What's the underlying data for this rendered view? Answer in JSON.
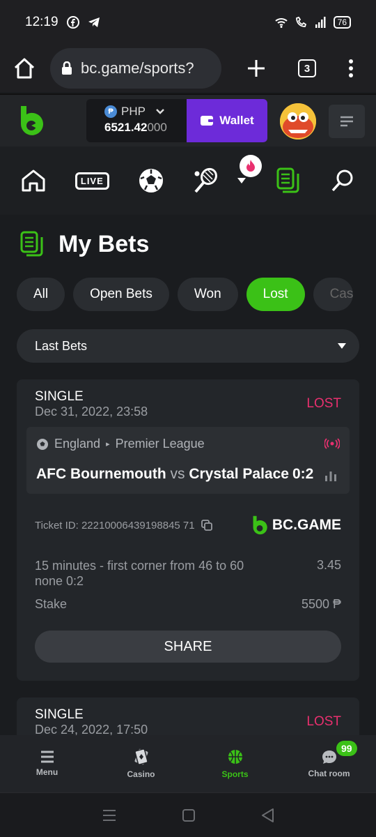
{
  "status": {
    "time": "12:19",
    "battery": "76"
  },
  "browser": {
    "url": "bc.game/sports?",
    "tab_count": "3"
  },
  "header": {
    "currency": "PHP",
    "balance_main": "6521.42",
    "balance_tail": "000",
    "wallet_label": "Wallet"
  },
  "sport_nav": {
    "live_label": "LIVE"
  },
  "page": {
    "title": "My Bets"
  },
  "filters": [
    "All",
    "Open Bets",
    "Won",
    "Lost",
    "Cas"
  ],
  "select": {
    "value": "Last Bets"
  },
  "bets": [
    {
      "type": "SINGLE",
      "date": "Dec 31, 2022, 23:58",
      "status": "LOST",
      "country": "England",
      "league": "Premier League",
      "home": "AFC Bournemouth",
      "vs": "vs",
      "away": "Crystal Palace",
      "score": "0:2",
      "ticket": "Ticket ID: 22210006439198845 71",
      "brand": "BC.GAME",
      "market": "15 minutes - first corner from 46 to 60",
      "selection": "none  0:2",
      "odds": "3.45",
      "stake_label": "Stake",
      "stake_value": "5500 ₱",
      "share_label": "SHARE"
    },
    {
      "type": "SINGLE",
      "date": "Dec 24, 2022, 17:50",
      "status": "LOST"
    }
  ],
  "bottom_nav": [
    {
      "label": "Menu"
    },
    {
      "label": "Casino"
    },
    {
      "label": "Sports"
    },
    {
      "label": "Chat room",
      "badge": "99"
    }
  ],
  "colors": {
    "accent": "#3bc117",
    "lost": "#e9306f",
    "wallet": "#6d2bd9"
  }
}
